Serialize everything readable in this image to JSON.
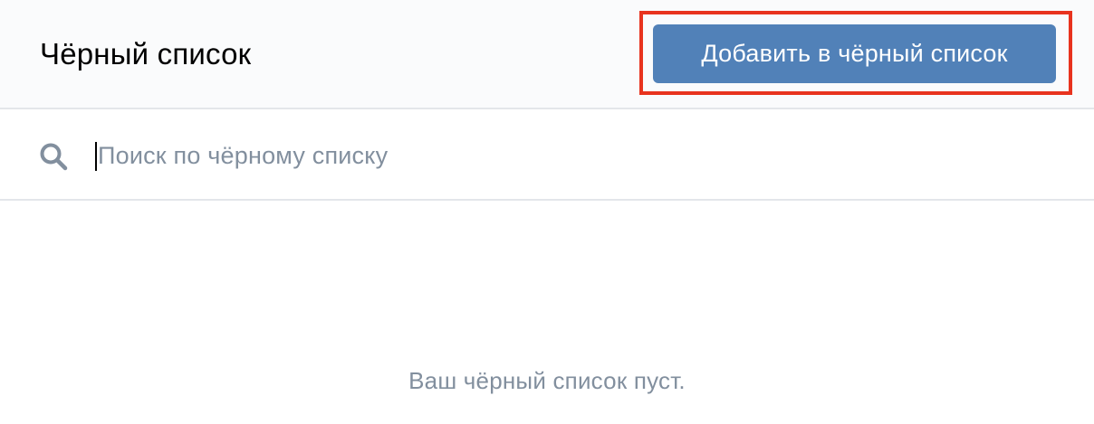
{
  "header": {
    "title": "Чёрный список",
    "add_button_label": "Добавить в чёрный список"
  },
  "search": {
    "placeholder": "Поиск по чёрному списку",
    "value": "",
    "icon": "search-icon"
  },
  "empty_state": {
    "message": "Ваш чёрный список пуст."
  },
  "colors": {
    "accent": "#5181b8",
    "highlight": "#e8331e",
    "muted_text": "#828f9e",
    "header_bg": "#fafbfc",
    "divider": "#e3e6ea"
  }
}
